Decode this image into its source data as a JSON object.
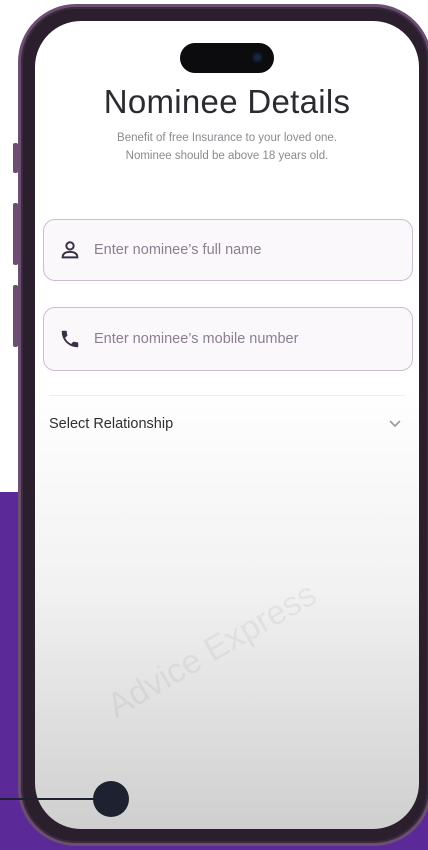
{
  "header": {
    "title": "Nominee Details",
    "subtitle_line1": "Benefit of free Insurance to your loved one.",
    "subtitle_line2": "Nominee should be above 18 years old."
  },
  "form": {
    "name_field": {
      "placeholder": "Enter nominee’s full name",
      "icon": "person-icon"
    },
    "mobile_field": {
      "placeholder": "Enter nominee’s mobile number",
      "icon": "phone-icon"
    },
    "relationship": {
      "label": "Select Relationship",
      "icon": "chevron-down-icon"
    }
  },
  "watermark": "Advice Express",
  "colors": {
    "accent_purple": "#5b2a98",
    "field_border": "#cbbccf",
    "icon_dark": "#3b2f44"
  }
}
